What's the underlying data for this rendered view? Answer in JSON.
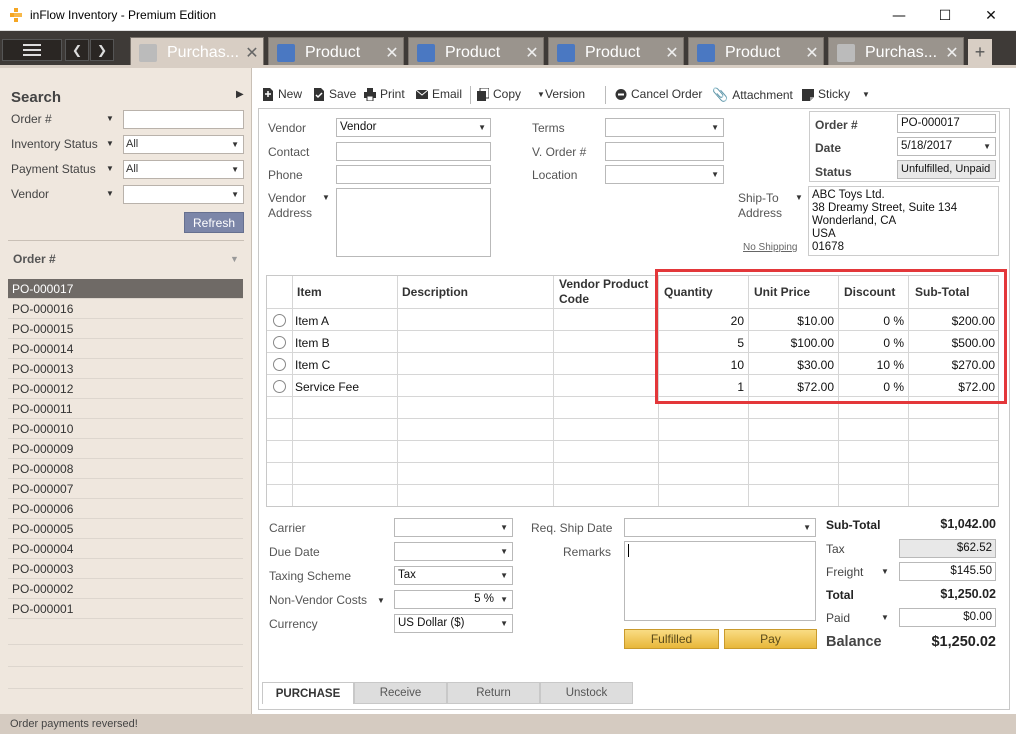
{
  "window": {
    "title": "inFlow Inventory - Premium Edition",
    "minimize": "—",
    "maximize": "☐",
    "close": "✕"
  },
  "tabs": [
    {
      "label": "Purchas...",
      "type": "purchase",
      "active": true
    },
    {
      "label": "Product",
      "type": "product",
      "active": false
    },
    {
      "label": "Product",
      "type": "product",
      "active": false
    },
    {
      "label": "Product",
      "type": "product",
      "active": false
    },
    {
      "label": "Product",
      "type": "product",
      "active": false
    },
    {
      "label": "Purchas...",
      "type": "purchase",
      "active": false
    }
  ],
  "tab_close": "✕",
  "tab_add": "+",
  "sidebar": {
    "search_title": "Search",
    "filters": [
      {
        "label": "Order #",
        "value": "",
        "dropdown": false
      },
      {
        "label": "Inventory Status",
        "value": "All",
        "dropdown": true
      },
      {
        "label": "Payment Status",
        "value": "All",
        "dropdown": true
      },
      {
        "label": "Vendor",
        "value": "",
        "dropdown": true
      }
    ],
    "refresh_label": "Refresh",
    "list_header": "Order #",
    "orders": [
      "PO-000017",
      "PO-000016",
      "PO-000015",
      "PO-000014",
      "PO-000013",
      "PO-000012",
      "PO-000011",
      "PO-000010",
      "PO-000009",
      "PO-000008",
      "PO-000007",
      "PO-000006",
      "PO-000005",
      "PO-000004",
      "PO-000003",
      "PO-000002",
      "PO-000001"
    ],
    "selected_order": "PO-000017"
  },
  "toolbar": {
    "new": "New",
    "save": "Save",
    "print": "Print",
    "email": "Email",
    "copy": "Copy",
    "version": "Version",
    "cancel_order": "Cancel Order",
    "attachment": "Attachment",
    "sticky": "Sticky"
  },
  "form": {
    "vendor_label": "Vendor",
    "vendor_value": "Vendor",
    "contact_label": "Contact",
    "contact_value": "",
    "phone_label": "Phone",
    "phone_value": "",
    "vendor_address_label_1": "Vendor",
    "vendor_address_label_2": "Address",
    "terms_label": "Terms",
    "terms_value": "",
    "vorder_label": "V. Order #",
    "vorder_value": "",
    "location_label": "Location",
    "location_value": "",
    "order_no_label": "Order #",
    "order_no_value": "PO-000017",
    "date_label": "Date",
    "date_value": "5/18/2017",
    "status_label": "Status",
    "status_value": "Unfulfilled, Unpaid",
    "shipto_label_1": "Ship-To",
    "shipto_label_2": "Address",
    "no_shipping": "No Shipping",
    "shipto_lines": [
      "ABC Toys Ltd.",
      "38 Dreamy Street, Suite 134",
      "Wonderland, CA",
      "USA",
      "01678"
    ]
  },
  "grid": {
    "headers": {
      "item": "Item",
      "description": "Description",
      "vendor_code_1": "Vendor Product",
      "vendor_code_2": "Code",
      "quantity": "Quantity",
      "unit_price": "Unit Price",
      "discount": "Discount",
      "subtotal": "Sub-Total"
    },
    "rows": [
      {
        "item": "Item A",
        "quantity": "20",
        "unit_price": "$10.00",
        "discount": "0 %",
        "subtotal": "$200.00"
      },
      {
        "item": "Item B",
        "quantity": "5",
        "unit_price": "$100.00",
        "discount": "0 %",
        "subtotal": "$500.00"
      },
      {
        "item": "Item C",
        "quantity": "10",
        "unit_price": "$30.00",
        "discount": "10 %",
        "subtotal": "$270.00"
      },
      {
        "item": "Service Fee",
        "quantity": "1",
        "unit_price": "$72.00",
        "discount": "0 %",
        "subtotal": "$72.00"
      }
    ]
  },
  "lower": {
    "carrier_label": "Carrier",
    "carrier_value": "",
    "due_date_label": "Due Date",
    "due_date_value": "",
    "taxing_label": "Taxing Scheme",
    "taxing_value": "Tax",
    "nonvendor_label": "Non-Vendor Costs",
    "nonvendor_value": "5 %",
    "currency_label": "Currency",
    "currency_value": "US Dollar  ($)",
    "req_ship_label": "Req. Ship Date",
    "req_ship_value": "",
    "remarks_label": "Remarks",
    "fulfilled_label": "Fulfilled",
    "pay_label": "Pay"
  },
  "totals": {
    "subtotal_label": "Sub-Total",
    "subtotal_value": "$1,042.00",
    "tax_label": "Tax",
    "tax_value": "$62.52",
    "freight_label": "Freight",
    "freight_value": "$145.50",
    "total_label": "Total",
    "total_value": "$1,250.02",
    "paid_label": "Paid",
    "paid_value": "$0.00",
    "balance_label": "Balance",
    "balance_value": "$1,250.02"
  },
  "bottom_tabs": [
    "PURCHASE",
    "Receive",
    "Return",
    "Unstock"
  ],
  "status_message": "Order payments reversed!",
  "colors": {
    "highlight": "#e3373a",
    "selected_row": "#6f6a66",
    "accent": "#f0c14b"
  }
}
